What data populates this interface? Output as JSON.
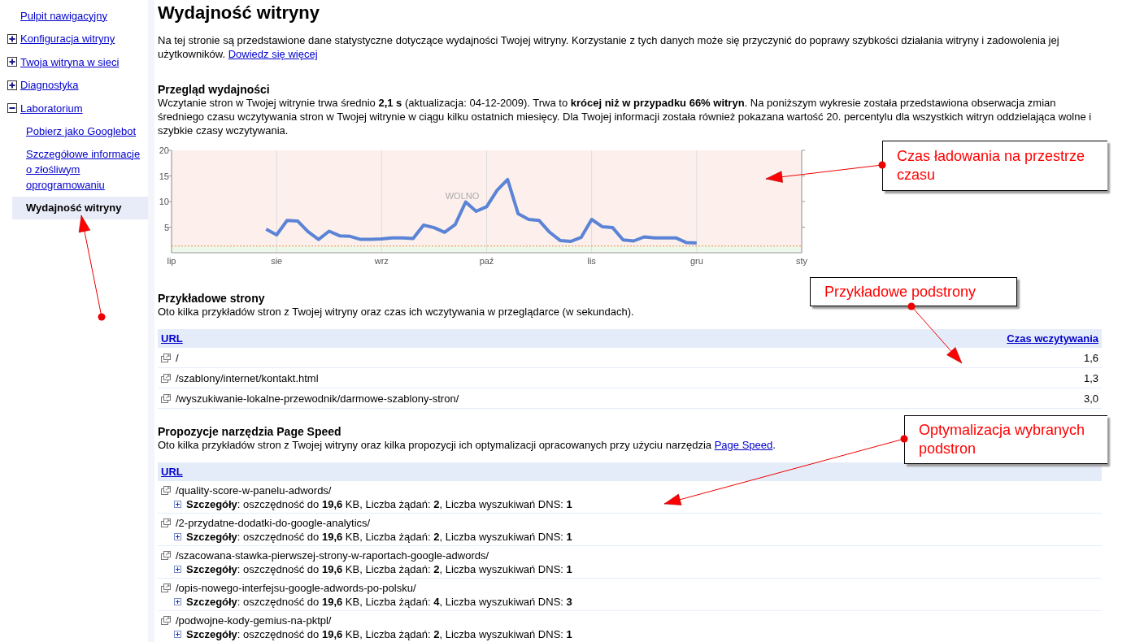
{
  "sidebar": {
    "items": [
      {
        "kind": "link",
        "label": "Pulpit nawigacyjny",
        "selected": false
      },
      {
        "kind": "group",
        "label": "Konfiguracja witryny",
        "expanded": false,
        "selected": false
      },
      {
        "kind": "group",
        "label": "Twoja witryna w sieci",
        "expanded": false,
        "selected": false
      },
      {
        "kind": "group",
        "label": "Diagnostyka",
        "expanded": false,
        "selected": false
      },
      {
        "kind": "group",
        "label": "Laboratorium",
        "expanded": true,
        "selected": false,
        "children": [
          {
            "label": "Pobierz jako Googlebot",
            "selected": false
          },
          {
            "label": "Szczegółowe informacje o złośliwym oprogramowaniu",
            "selected": false
          },
          {
            "label": "Wydajność witryny",
            "selected": true
          }
        ]
      }
    ]
  },
  "title": "Wydajność witryny",
  "intro": {
    "text": "Na tej stronie są przedstawione dane statystyczne dotyczące wydajności Twojej witryny. Korzystanie z tych danych może się przyczynić do poprawy szybkości działania witryny i zadowolenia jej użytkowników.",
    "link": "Dowiedz się więcej"
  },
  "overview": {
    "heading": "Przegląd wydajności",
    "text": "Wczytanie stron w Twojej witrynie trwa średnio **2,1 s** (aktualizacja: 04-12-2009). Trwa to **krócej niż w przypadku 66% witryn**. Na poniższym wykresie została przedstawiona obserwacja zmian średniego czasu wczytywania stron w Twojej witrynie w ciągu kilku ostatnich miesięcy. Dla Twojej informacji została również pokazana wartość 20. percentylu dla wszystkich witryn oddzielająca wolne i szybkie czasy wczytywania.",
    "chart_data": {
      "type": "line",
      "ylim": [
        0,
        20
      ],
      "grid": true,
      "categories": [
        "lip",
        null,
        null,
        null,
        null,
        null,
        null,
        null,
        null,
        null,
        "sie",
        null,
        null,
        null,
        null,
        null,
        null,
        null,
        null,
        null,
        "wrz",
        null,
        null,
        null,
        null,
        null,
        null,
        null,
        null,
        null,
        "paź",
        null,
        null,
        null,
        null,
        null,
        null,
        null,
        null,
        null,
        "lis",
        null,
        null,
        null,
        null,
        null,
        null,
        null,
        null,
        null,
        "gru",
        null,
        null,
        null,
        null,
        null,
        null,
        null,
        null,
        null,
        "sty"
      ],
      "yticks": [
        5,
        10,
        15,
        20
      ],
      "ref_lines": [
        {
          "axis": "y",
          "value": 1.3
        }
      ],
      "annotations": [
        {
          "text": "WOLNO",
          "y": 10.5
        }
      ],
      "series": [
        {
          "color": "#5b83d6",
          "values": [
            null,
            null,
            null,
            null,
            null,
            null,
            null,
            null,
            null,
            4.6,
            3.5,
            6.3,
            6.2,
            4.1,
            2.6,
            4.2,
            3.3,
            3.2,
            2.6,
            2.6,
            2.7,
            2.9,
            2.9,
            2.8,
            5.4,
            4.9,
            4.0,
            5.5,
            9.9,
            8.1,
            9.0,
            12.2,
            14.3,
            7.6,
            6.5,
            6.3,
            4.0,
            2.4,
            2.2,
            3.0,
            6.5,
            5.1,
            4.9,
            2.5,
            2.3,
            3.1,
            2.9,
            2.9,
            2.9,
            2.0,
            1.9,
            null,
            null,
            null,
            null,
            null,
            null,
            null,
            null,
            null,
            null
          ]
        }
      ]
    }
  },
  "samples": {
    "heading": "Przykładowe strony",
    "text": "Oto kilka przykładów stron z Twojej witryny oraz czas ich wczytywania w przeglądarce (w sekundach).",
    "columns": [
      "URL",
      "Czas wczytywania"
    ],
    "rows": [
      {
        "url": "/",
        "time": "1,6"
      },
      {
        "url": "/szablony/internet/kontakt.html",
        "time": "1,3"
      },
      {
        "url": "/wyszukiwanie-lokalne-przewodnik/darmowe-szablony-stron/",
        "time": "3,0"
      }
    ]
  },
  "pagespeed": {
    "heading": "Propozycje narzędzia Page Speed",
    "text": "Oto kilka przykładów stron z Twojej witryny oraz kilka propozycji ich optymalizacji opracowanych przy użyciu narzędzia",
    "link": "Page Speed",
    "after": ".",
    "columns": [
      "URL"
    ],
    "rows": [
      {
        "url": "/quality-score-w-panelu-adwords/",
        "expanded": false,
        "details": "**Szczegóły**: oszczędność do **19,6** KB, Liczba żądań: **2**, Liczba wyszukiwań DNS: **1**"
      },
      {
        "url": "/2-przydatne-dodatki-do-google-analytics/",
        "expanded": false,
        "details": "**Szczegóły**: oszczędność do **19,6** KB, Liczba żądań: **2**, Liczba wyszukiwań DNS: **1**"
      },
      {
        "url": "/szacowana-stawka-pierwszej-strony-w-raportach-google-adwords/",
        "expanded": false,
        "details": "**Szczegóły**: oszczędność do **19,6** KB, Liczba żądań: **2**, Liczba wyszukiwań DNS: **1**"
      },
      {
        "url": "/opis-nowego-interfejsu-google-adwords-po-polsku/",
        "expanded": false,
        "details": "**Szczegóły**: oszczędność do **19,6** KB, Liczba żądań: **4**, Liczba wyszukiwań DNS: **3**"
      },
      {
        "url": "/podwojne-kody-gemius-na-pktpl/",
        "expanded": false,
        "details": "**Szczegóły**: oszczędność do **19,6** KB, Liczba żądań: **2**, Liczba wyszukiwań DNS: **1**"
      }
    ]
  },
  "callouts": [
    {
      "lines": [
        "Czas ładowania na przestrze",
        "czasu"
      ]
    },
    {
      "lines": [
        "Przykładowe podstrony"
      ]
    },
    {
      "lines": [
        "Optymalizacja wybranych",
        "podstron"
      ]
    }
  ]
}
